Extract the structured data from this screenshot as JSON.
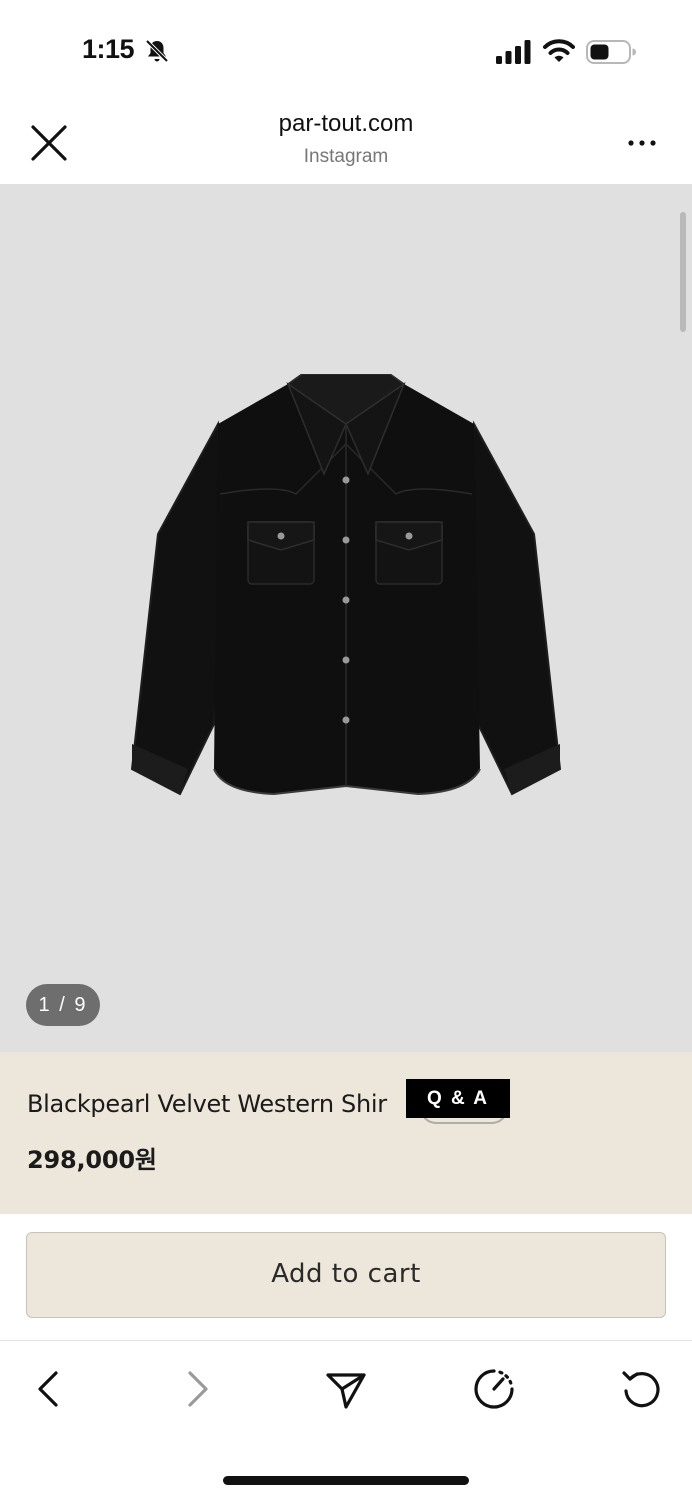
{
  "status_bar": {
    "time": "1:15",
    "icons": [
      "bell-slash-icon",
      "signal-icon",
      "wifi-icon",
      "battery-icon"
    ]
  },
  "browser": {
    "domain": "par-tout.com",
    "source": "Instagram",
    "close_icon": "close-icon",
    "menu_icon": "more-icon"
  },
  "gallery": {
    "counter": "1 / 9",
    "image_alt": "Black velvet western shirt"
  },
  "product": {
    "title": "Blackpearl Velvet Western Shir",
    "qa_label": "Q & A",
    "price": "298,000원"
  },
  "cart": {
    "button_label": "Add to cart"
  },
  "toolbar": {
    "icons": [
      "back-icon",
      "forward-icon",
      "share-icon",
      "speed-icon",
      "reload-icon"
    ]
  },
  "colors": {
    "info_background": "#ede6da",
    "image_background": "#e0e0e0",
    "badge": "#000000"
  }
}
